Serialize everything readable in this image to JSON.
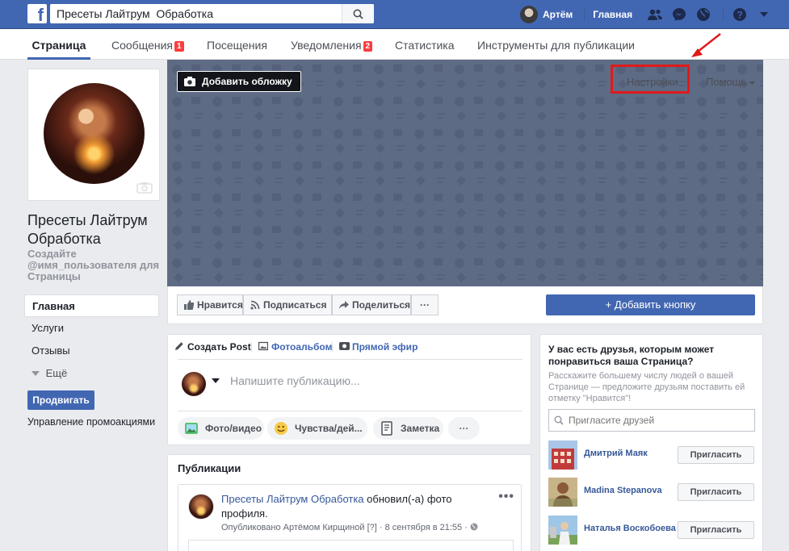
{
  "topbar": {
    "search_value": "Пресеты Лайтрум  Обработка",
    "user_name": "Артём",
    "home_label": "Главная"
  },
  "pagenav": {
    "tabs": [
      {
        "label": "Страница"
      },
      {
        "label": "Сообщения",
        "badge": "1"
      },
      {
        "label": "Посещения"
      },
      {
        "label": "Уведомления",
        "badge": "2"
      },
      {
        "label": "Статистика"
      },
      {
        "label": "Инструменты для публикации"
      }
    ]
  },
  "left": {
    "page_name": "Пресеты Лайтрум Обработка",
    "username_prompt": "Создайте @имя_пользователя для Страницы",
    "nav": [
      "Главная",
      "Услуги",
      "Отзывы",
      "Ещё"
    ],
    "promote_label": "Продвигать",
    "promo_manage_label": "Управление промоакциями"
  },
  "cover": {
    "add_cover_label": "Добавить обложку",
    "settings_label": "Настройки",
    "help_label": "Помощь",
    "accent_color": "#e0191b"
  },
  "actions": {
    "like": "Нравится",
    "follow": "Подписаться",
    "share": "Поделиться",
    "more": "···",
    "add_button": "+ Добавить кнопку"
  },
  "composer": {
    "tab_post": "Создать Post",
    "tab_album": "Фотоальбом",
    "tab_live": "Прямой эфир",
    "placeholder": "Напишите публикацию...",
    "photo_video": "Фото/видео",
    "feelings": "Чувства/дей...",
    "note": "Заметка",
    "more": "···"
  },
  "publications": {
    "title": "Публикации",
    "post": {
      "author": "Пресеты Лайтрум Обработка",
      "action": " обновил(-а) фото профиля.",
      "meta": "Опубликовано Артёмом Кирщиной [?] · 8 сентября в 21:55 ·",
      "dots": "•••"
    }
  },
  "invite": {
    "title": "У вас есть друзья, которым может понравиться ваша Страница?",
    "description": "Расскажите большему числу людей о вашей Странице — предложите друзьям поставить ей отметку \"Нравится\"!",
    "search_placeholder": "Пригласите друзей",
    "invite_label": "Пригласить",
    "friends": [
      {
        "name": "Дмитрий Маяк"
      },
      {
        "name": "Madina Stepanova"
      },
      {
        "name": "Наталья Воскобоева"
      }
    ]
  },
  "colors": {
    "brand": "#4267b2",
    "badge": "#fa3e3e",
    "cover": "#5e6b84"
  }
}
